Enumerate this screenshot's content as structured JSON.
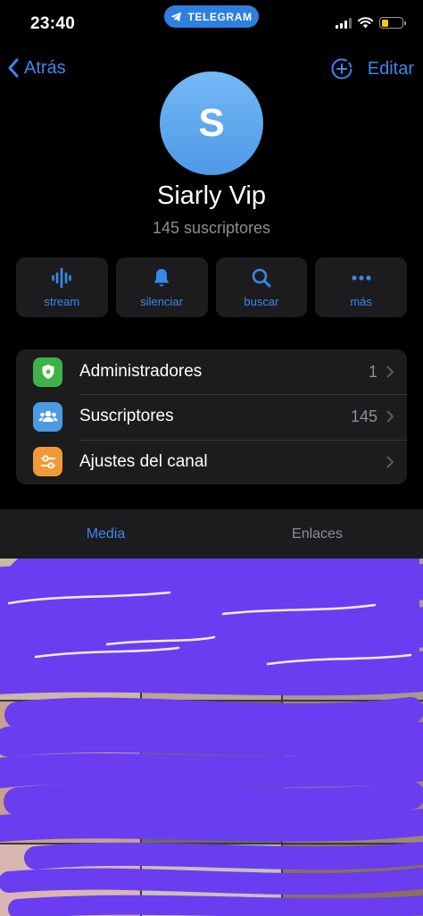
{
  "status_bar": {
    "time": "23:40",
    "pill_label": "TELEGRAM",
    "battery_color": "#f5c518"
  },
  "nav": {
    "back_label": "Atrás",
    "edit_label": "Editar",
    "back_icon": "chevron-left-icon",
    "add_icon": "plus-circle-icon"
  },
  "profile": {
    "avatar_letter": "S",
    "name": "Siarly Vip",
    "subscribers": "145 suscriptores"
  },
  "actions": [
    {
      "label": "stream",
      "icon": "stream-icon"
    },
    {
      "label": "silenciar",
      "icon": "bell-icon"
    },
    {
      "label": "buscar",
      "icon": "search-icon"
    },
    {
      "label": "más",
      "icon": "more-icon"
    }
  ],
  "info_rows": [
    {
      "label": "Administradores",
      "value": "1",
      "icon": "shield-icon",
      "color": "#3db249"
    },
    {
      "label": "Suscriptores",
      "value": "145",
      "icon": "people-icon",
      "color": "#4a9be2"
    },
    {
      "label": "Ajustes del canal",
      "value": "",
      "icon": "sliders-icon",
      "color": "#f09a37"
    }
  ],
  "tabs": {
    "media": "Media",
    "links": "Enlaces"
  },
  "colors": {
    "accent": "#3c86f0",
    "background": "#000000",
    "card": "#1c1c1e",
    "secondary_text": "#8d8d93",
    "redaction": "#6a3df0"
  }
}
